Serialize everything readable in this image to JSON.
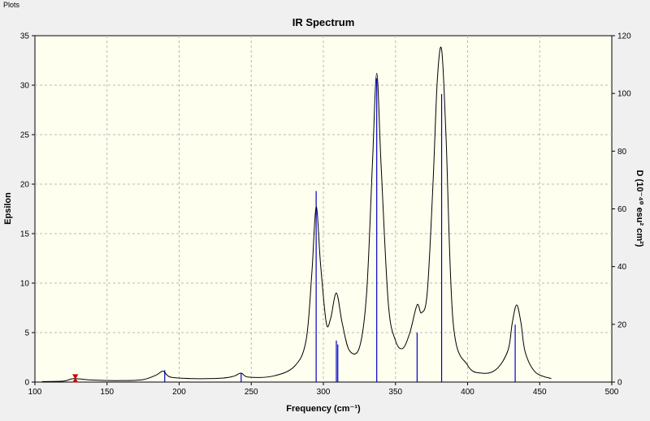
{
  "window": {
    "menu_title": "Plots"
  },
  "chart_data": {
    "type": "line",
    "title": "IR Spectrum",
    "xlabel": "Frequency (cm⁻¹)",
    "ylabel_left": "Epsilon",
    "ylabel_right": "D (10⁻⁴⁰ esu² cm²)",
    "xlim": [
      100,
      500
    ],
    "ylim_left": [
      0,
      35
    ],
    "ylim_right": [
      0,
      120
    ],
    "xticks": [
      100,
      150,
      200,
      250,
      300,
      350,
      400,
      450,
      500
    ],
    "yticks_left": [
      0,
      5,
      10,
      15,
      20,
      25,
      30,
      35
    ],
    "yticks_right": [
      0,
      20,
      40,
      60,
      80,
      100,
      120
    ],
    "grid": true,
    "series": [
      {
        "kind": "curve",
        "color": "#000000",
        "x": [
          105,
          120,
          127,
          140,
          160,
          175,
          184,
          189,
          194,
          210,
          230,
          238,
          243,
          248,
          265,
          280,
          288,
          292,
          295,
          298,
          302,
          305,
          309,
          313,
          318,
          325,
          330,
          334,
          337,
          340,
          345,
          350,
          355,
          360,
          365,
          368,
          372,
          376,
          379,
          382,
          385,
          390,
          400,
          410,
          420,
          428,
          431,
          434,
          437,
          440,
          447,
          458
        ],
        "y": [
          0.05,
          0.1,
          0.35,
          0.2,
          0.15,
          0.25,
          0.7,
          1.1,
          0.5,
          0.35,
          0.4,
          0.6,
          0.9,
          0.5,
          0.6,
          1.6,
          4.2,
          11.0,
          17.7,
          12.0,
          6.0,
          6.4,
          9.0,
          6.0,
          3.2,
          3.5,
          9.0,
          22.0,
          31.2,
          22.0,
          8.0,
          4.2,
          3.4,
          5.0,
          7.8,
          7.0,
          9.0,
          20.0,
          30.5,
          33.6,
          25.0,
          6.0,
          1.7,
          0.9,
          1.3,
          3.2,
          6.0,
          7.8,
          6.0,
          3.0,
          1.0,
          0.35
        ]
      },
      {
        "kind": "sticks",
        "color": "#0000c8",
        "x": [
          190,
          243,
          295,
          309,
          310,
          337,
          365,
          382,
          433
        ],
        "y": [
          1.2,
          0.9,
          19.3,
          4.2,
          3.8,
          30.7,
          5.0,
          29.1,
          5.8
        ]
      }
    ],
    "marker": {
      "x": 128,
      "y": 0.35,
      "color": "#cc0000"
    }
  }
}
